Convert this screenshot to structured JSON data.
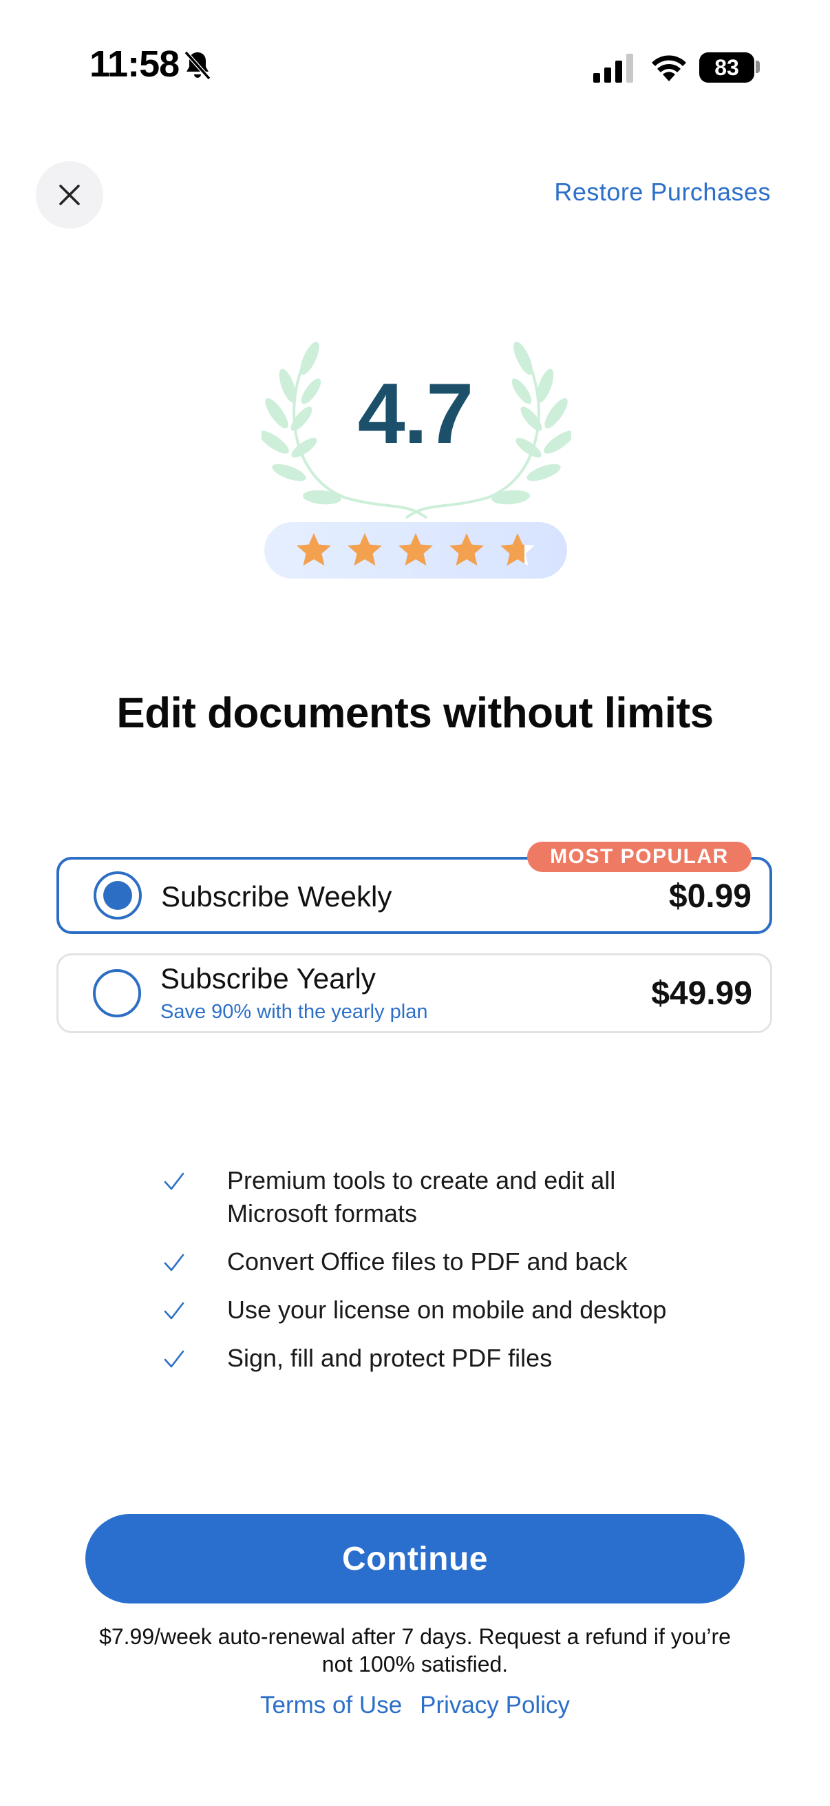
{
  "status_bar": {
    "time": "11:58",
    "battery": "83"
  },
  "header": {
    "restore_label": "Restore Purchases"
  },
  "rating": {
    "value": "4.7",
    "stars": 4.7
  },
  "headline": "Edit documents without limits",
  "plans": [
    {
      "title": "Subscribe Weekly",
      "subtitle": "",
      "price": "$0.99",
      "badge": "MOST POPULAR",
      "selected": true
    },
    {
      "title": "Subscribe Yearly",
      "subtitle": "Save 90% with the yearly plan",
      "price": "$49.99",
      "badge": "",
      "selected": false
    }
  ],
  "features": [
    "Premium tools to create and edit all Microsoft formats",
    "Convert Office files to PDF and back",
    "Use your license on mobile and desktop",
    "Sign, fill and protect PDF files"
  ],
  "cta": {
    "continue_label": "Continue",
    "disclaimer": "$7.99/week auto-renewal after 7 days. Request a refund if you’re not 100% satisfied."
  },
  "links": {
    "terms": "Terms of Use",
    "privacy": "Privacy Policy"
  },
  "colors": {
    "accent": "#2a6fcd",
    "badge": "#ef7a63",
    "rating_text": "#1b4f6a",
    "star": "#f3a04f",
    "laurel": "#cdeed9"
  }
}
